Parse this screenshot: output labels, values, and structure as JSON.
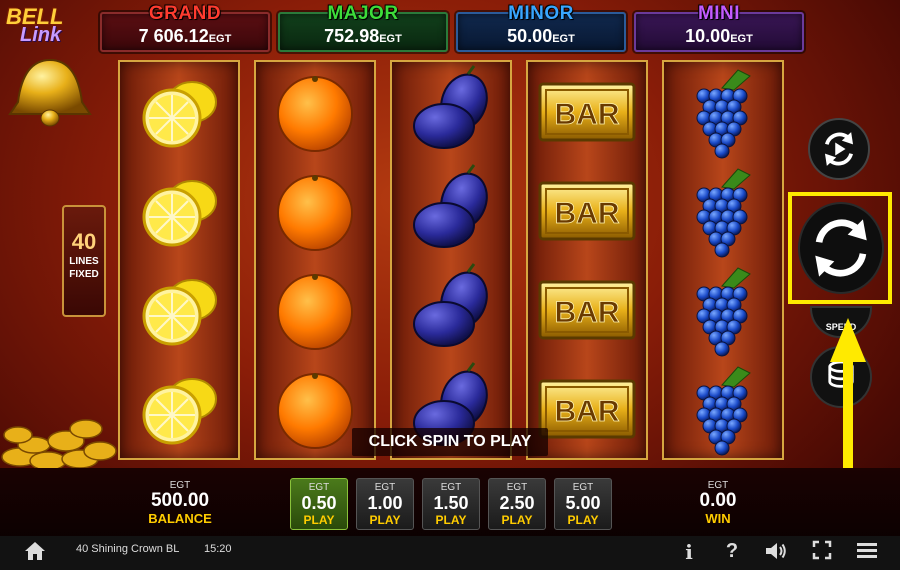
{
  "logo": {
    "line1": "BELL",
    "line2": "Link"
  },
  "jackpots": [
    {
      "label": "GRAND",
      "value": "7 606.12",
      "currency": "EGT",
      "color": "#ff3b2f"
    },
    {
      "label": "MAJOR",
      "value": "752.98",
      "currency": "EGT",
      "color": "#3ddc3a"
    },
    {
      "label": "MINOR",
      "value": "50.00",
      "currency": "EGT",
      "color": "#39a6ff"
    },
    {
      "label": "MINI",
      "value": "10.00",
      "currency": "EGT",
      "color": "#c35bff"
    }
  ],
  "lines": {
    "count": "40",
    "line1": "LINES",
    "line2": "FIXED"
  },
  "reels": [
    [
      "lemon",
      "lemon",
      "lemon",
      "lemon"
    ],
    [
      "orange",
      "orange",
      "orange",
      "orange"
    ],
    [
      "plum",
      "plum",
      "plum",
      "plum"
    ],
    [
      "bar",
      "bar",
      "bar",
      "bar"
    ],
    [
      "grapes",
      "grapes",
      "grapes",
      "grapes"
    ]
  ],
  "symbols": {
    "bar_text": "BAR"
  },
  "message": "CLICK SPIN TO PLAY",
  "controls": {
    "autospin_icon": "autoplay-icon",
    "spin_icon": "spin-icon",
    "speed_label": "SPEED",
    "highlight_color": "#ffea00"
  },
  "balance": {
    "currency": "EGT",
    "value": "500.00",
    "label": "BALANCE"
  },
  "win": {
    "currency": "EGT",
    "value": "0.00",
    "label": "WIN"
  },
  "bets": [
    {
      "currency": "EGT",
      "value": "0.50",
      "label": "PLAY",
      "selected": true
    },
    {
      "currency": "EGT",
      "value": "1.00",
      "label": "PLAY",
      "selected": false
    },
    {
      "currency": "EGT",
      "value": "1.50",
      "label": "PLAY",
      "selected": false
    },
    {
      "currency": "EGT",
      "value": "2.50",
      "label": "PLAY",
      "selected": false
    },
    {
      "currency": "EGT",
      "value": "5.00",
      "label": "PLAY",
      "selected": false
    }
  ],
  "status": {
    "game_name": "40 Shining Crown BL",
    "clock": "15:20",
    "info_glyph": "i",
    "help_glyph": "?"
  }
}
